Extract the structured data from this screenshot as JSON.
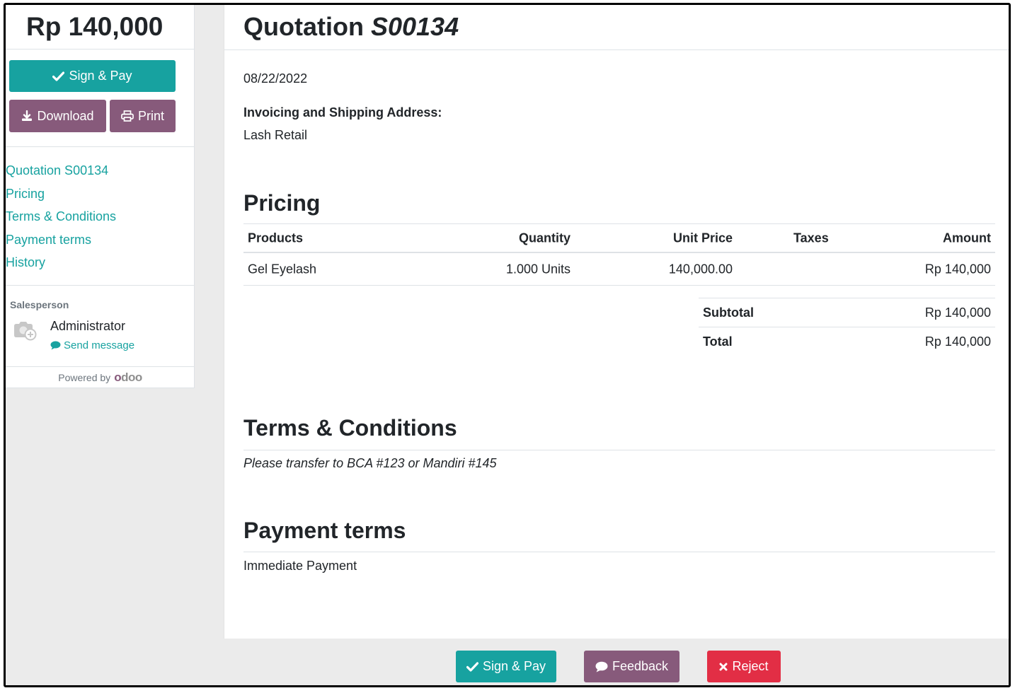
{
  "sidebar": {
    "amount_total": "Rp 140,000",
    "sign_pay_label": "Sign & Pay",
    "download_label": "Download",
    "print_label": "Print",
    "nav": [
      {
        "label": "Quotation S00134"
      },
      {
        "label": "Pricing"
      },
      {
        "label": "Terms & Conditions"
      },
      {
        "label": "Payment terms"
      },
      {
        "label": "History"
      }
    ],
    "salesperson_title": "Salesperson",
    "salesperson_name": "Administrator",
    "send_message_label": "Send message",
    "powered_by": "Powered by",
    "brand": "odoo"
  },
  "quote": {
    "title_prefix": "Quotation",
    "number": "S00134",
    "date": "08/22/2022",
    "address_label": "Invoicing and Shipping Address:",
    "address_value": "Lash Retail"
  },
  "pricing": {
    "heading": "Pricing",
    "columns": {
      "product": "Products",
      "quantity": "Quantity",
      "unit_price": "Unit Price",
      "taxes": "Taxes",
      "amount": "Amount"
    },
    "rows": [
      {
        "product": "Gel Eyelash",
        "quantity": "1.000 Units",
        "unit_price": "140,000.00",
        "taxes": "",
        "amount": "Rp 140,000"
      }
    ],
    "subtotal_label": "Subtotal",
    "subtotal_value": "Rp 140,000",
    "total_label": "Total",
    "total_value": "Rp 140,000"
  },
  "terms": {
    "heading": "Terms & Conditions",
    "text": "Please transfer to BCA #123 or Mandiri #145"
  },
  "payment_terms": {
    "heading": "Payment terms",
    "text": "Immediate Payment"
  },
  "actions": {
    "sign_pay_label": "Sign & Pay",
    "feedback_label": "Feedback",
    "reject_label": "Reject"
  },
  "colors": {
    "teal": "#17a2a0",
    "purple": "#875a7b",
    "red": "#e22e45"
  }
}
